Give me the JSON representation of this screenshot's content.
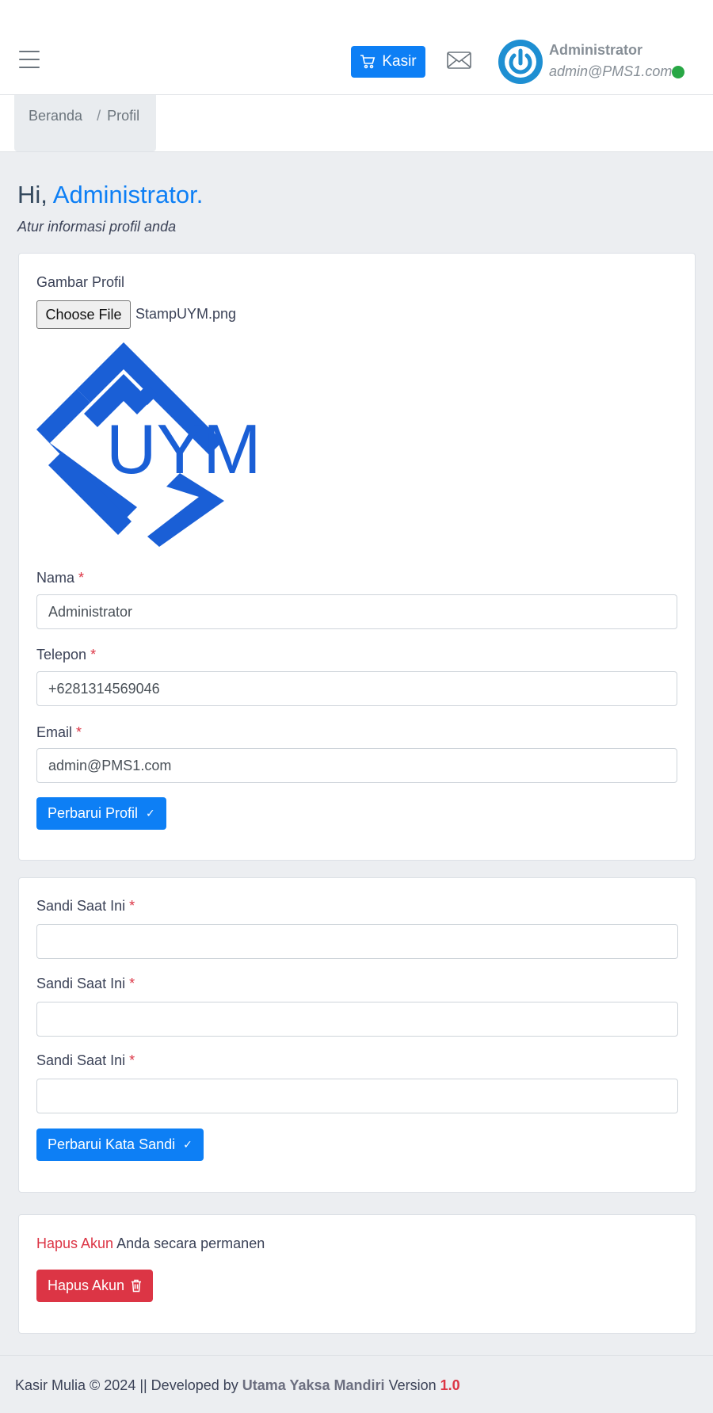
{
  "header": {
    "kasir_label": "Kasir",
    "user_name": "Administrator",
    "user_email": "admin@PMS1.com",
    "status_color": "#28a745",
    "accent_color": "#0d7ff5"
  },
  "breadcrumb": {
    "home": "Beranda",
    "separator": "/",
    "current": "Profil"
  },
  "greeting": {
    "hi": "Hi,",
    "name": "Administrator.",
    "subtitle": "Atur informasi profil anda"
  },
  "profile_form": {
    "picture_label": "Gambar Profil",
    "file_button": "Choose File",
    "file_name": "StampUYM.png",
    "logo_text": "UYM",
    "name_label": "Nama",
    "name_value": "Administrator",
    "phone_label": "Telepon",
    "phone_value": "+6281314569046",
    "email_label": "Email",
    "email_value": "admin@PMS1.com",
    "required_mark": "*",
    "submit_label": "Perbarui Profil"
  },
  "password_form": {
    "fields": [
      {
        "label": "Sandi Saat Ini",
        "value": ""
      },
      {
        "label": "Sandi Saat Ini",
        "value": ""
      },
      {
        "label": "Sandi Saat Ini",
        "value": ""
      }
    ],
    "required_mark": "*",
    "submit_label": "Perbarui Kata Sandi"
  },
  "delete_section": {
    "emphasis": "Hapus Akun",
    "rest": "Anda secara permanen",
    "button_label": "Hapus Akun"
  },
  "footer": {
    "prefix": "Kasir Mulia © 2024 || Developed by",
    "developer": "Utama Yaksa Mandiri",
    "version_label": "Version",
    "version": "1.0"
  },
  "icons": {
    "menu": "hamburger-icon",
    "cart": "cart-icon",
    "mail": "mail-icon",
    "avatar": "power-icon",
    "check": "check-icon",
    "trash": "trash-icon"
  }
}
